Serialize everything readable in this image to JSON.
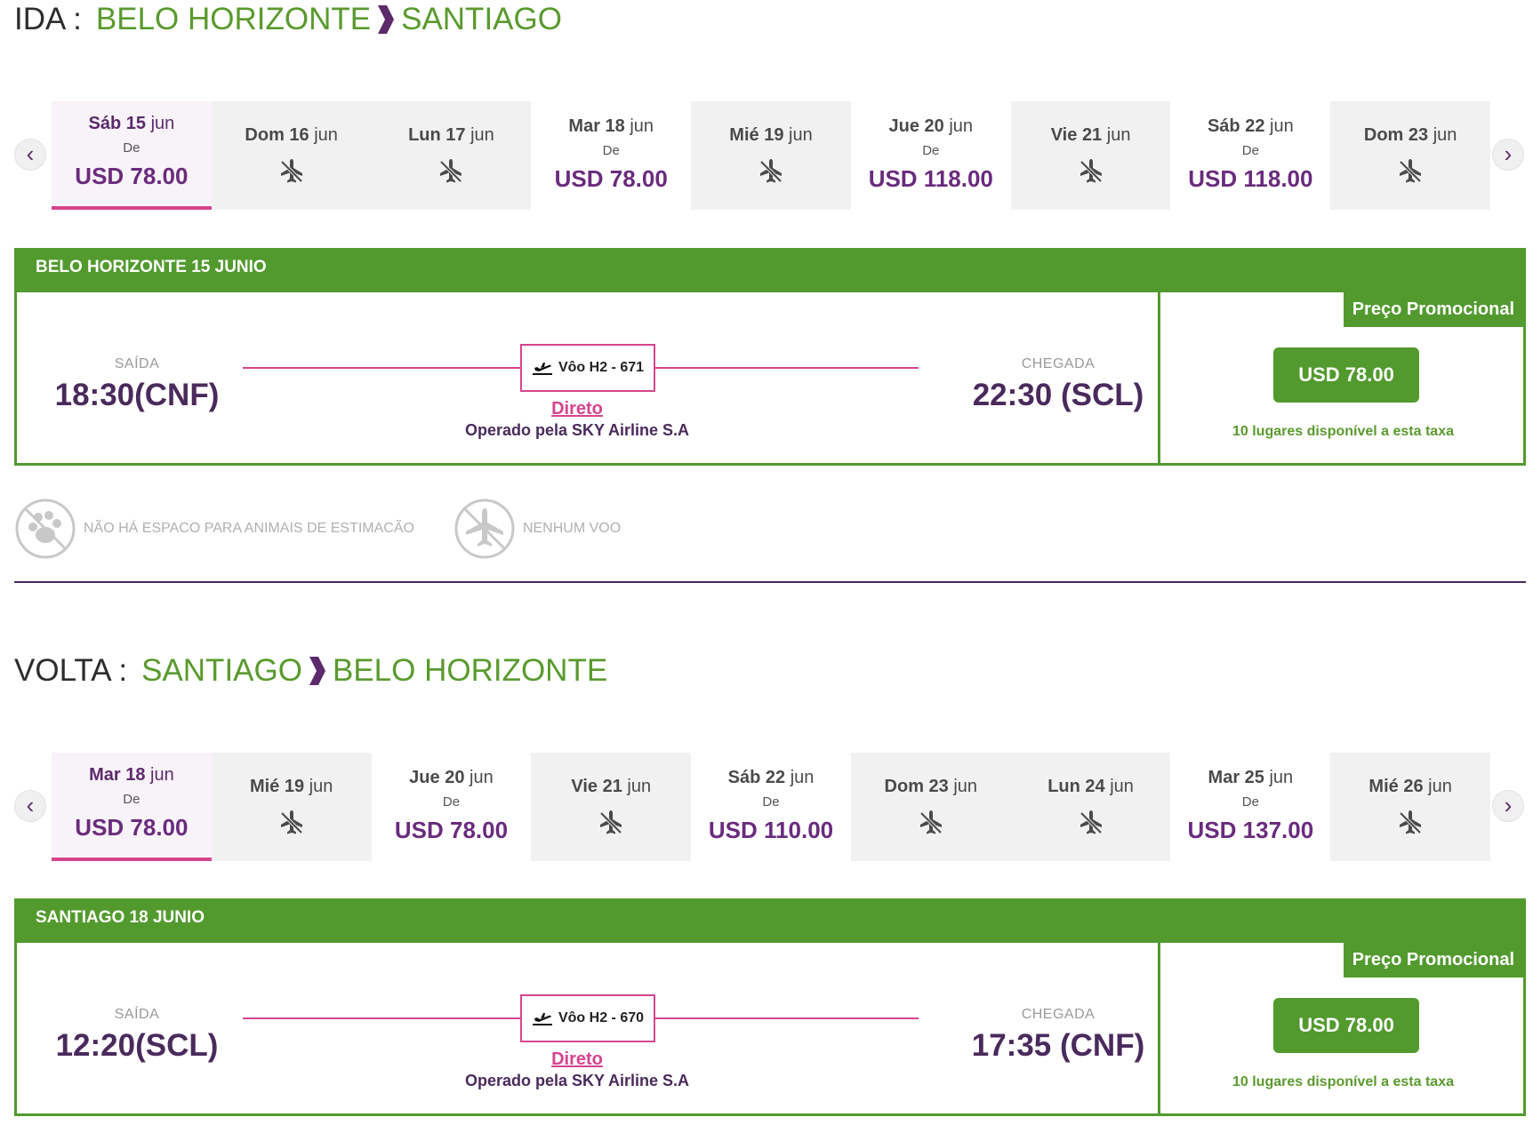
{
  "outbound": {
    "leg_label": "IDA :",
    "from": "BELO HORIZONTE",
    "to": "SANTIAGO",
    "dates": [
      {
        "day": "Sáb",
        "num": "15",
        "month": "jun",
        "from_label": "De",
        "price": "USD 78.00",
        "selected": true
      },
      {
        "day": "Dom",
        "num": "16",
        "month": "jun",
        "price": null
      },
      {
        "day": "Lun",
        "num": "17",
        "month": "jun",
        "price": null
      },
      {
        "day": "Mar",
        "num": "18",
        "month": "jun",
        "from_label": "De",
        "price": "USD 78.00"
      },
      {
        "day": "Mié",
        "num": "19",
        "month": "jun",
        "price": null
      },
      {
        "day": "Jue",
        "num": "20",
        "month": "jun",
        "from_label": "De",
        "price": "USD 118.00"
      },
      {
        "day": "Vie",
        "num": "21",
        "month": "jun",
        "price": null
      },
      {
        "day": "Sáb",
        "num": "22",
        "month": "jun",
        "from_label": "De",
        "price": "USD 118.00"
      },
      {
        "day": "Dom",
        "num": "23",
        "month": "jun",
        "price": null
      }
    ],
    "card": {
      "header": "BELO HORIZONTE 15 JUNIO",
      "departure_label": "SAÍDA",
      "departure_time": "18:30(CNF)",
      "arrival_label": "CHEGADA",
      "arrival_time": "22:30 (SCL)",
      "flight": "Vôo H2 - 671",
      "direct": "Direto",
      "operator": "Operado pela SKY Airline S.A",
      "promo_label": "Preço Promocional",
      "price": "USD 78.00",
      "seats": "10 lugares disponível a esta taxa"
    }
  },
  "info": {
    "pets": "NÃO HÁ ESPACO PARA ANIMAIS DE ESTIMACÃO",
    "no_flight": "NENHUM VOO"
  },
  "return": {
    "leg_label": "VOLTA :",
    "from": "SANTIAGO",
    "to": "BELO HORIZONTE",
    "dates": [
      {
        "day": "Mar",
        "num": "18",
        "month": "jun",
        "from_label": "De",
        "price": "USD 78.00",
        "selected": true
      },
      {
        "day": "Mié",
        "num": "19",
        "month": "jun",
        "price": null
      },
      {
        "day": "Jue",
        "num": "20",
        "month": "jun",
        "from_label": "De",
        "price": "USD 78.00"
      },
      {
        "day": "Vie",
        "num": "21",
        "month": "jun",
        "price": null
      },
      {
        "day": "Sáb",
        "num": "22",
        "month": "jun",
        "from_label": "De",
        "price": "USD 110.00"
      },
      {
        "day": "Dom",
        "num": "23",
        "month": "jun",
        "price": null
      },
      {
        "day": "Lun",
        "num": "24",
        "month": "jun",
        "price": null
      },
      {
        "day": "Mar",
        "num": "25",
        "month": "jun",
        "from_label": "De",
        "price": "USD 137.00"
      },
      {
        "day": "Mié",
        "num": "26",
        "month": "jun",
        "price": null
      }
    ],
    "card": {
      "header": "SANTIAGO 18 JUNIO",
      "departure_label": "SAÍDA",
      "departure_time": "12:20(SCL)",
      "arrival_label": "CHEGADA",
      "arrival_time": "17:35 (CNF)",
      "flight": "Vôo H2 - 670",
      "direct": "Direto",
      "operator": "Operado pela SKY Airline S.A",
      "promo_label": "Preço Promocional",
      "price": "USD 78.00",
      "seats": "10 lugares disponível a esta taxa"
    }
  },
  "nav": {
    "prev": "‹",
    "next": "›"
  },
  "colors": {
    "green": "#529a2e",
    "purple": "#6a2b7d",
    "pink": "#d6448e"
  }
}
